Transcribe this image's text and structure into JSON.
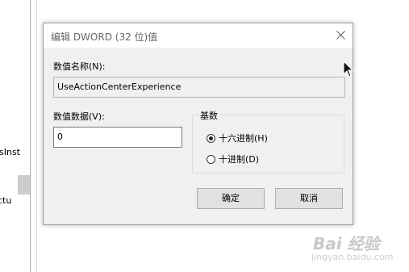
{
  "background": {
    "clipped_text_1": "sInst",
    "clipped_text_2": "ctu"
  },
  "dialog": {
    "title": "编辑 DWORD (32 位)值",
    "name_label": "数值名称(N):",
    "name_value": "UseActionCenterExperience",
    "data_label": "数值数据(V):",
    "data_value": "0",
    "base": {
      "label": "基数",
      "options": [
        {
          "label": "十六进制(H)",
          "checked": true
        },
        {
          "label": "十进制(D)",
          "checked": false
        }
      ]
    },
    "ok_label": "确定",
    "cancel_label": "取消"
  },
  "icons": {
    "close": "close-icon",
    "cursor": "mouse-pointer-icon"
  },
  "watermark": {
    "logo": "Bai 经验",
    "url": "jingyan.baidu.com"
  },
  "colors": {
    "dialog_bg": "#f0f0f0",
    "button_bg": "#e1e1e1"
  }
}
